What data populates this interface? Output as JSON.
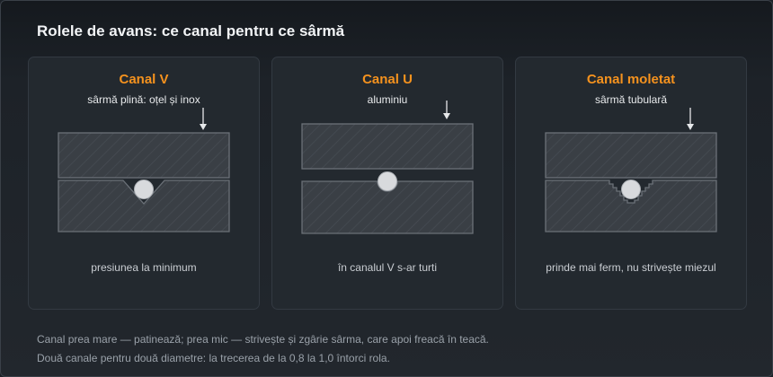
{
  "title": "Rolele de avans: ce canal pentru ce sârmă",
  "colors": {
    "accent": "#f5921e",
    "roll_fill": "#3a3f45",
    "roll_stroke": "#6b7178",
    "wire": "#d8dadd"
  },
  "cards": [
    {
      "heading": "Canal V",
      "subtitle": "sârmă plină: oțel și inox",
      "caption": "presiunea la minimum",
      "groove": "v",
      "arrow_icon": "arrow-down-icon"
    },
    {
      "heading": "Canal U",
      "subtitle": "aluminiu",
      "caption": "în canalul V s-ar turti",
      "groove": "u",
      "arrow_icon": "arrow-down-icon"
    },
    {
      "heading": "Canal moletat",
      "subtitle": "sârmă tubulară",
      "caption": "prinde mai ferm, nu strivește miezul",
      "groove": "knurled",
      "arrow_icon": "arrow-down-icon"
    }
  ],
  "footer": {
    "line1": "Canal prea mare — patinează; prea mic — strivește și zgârie sârma, care apoi freacă în teacă.",
    "line2": "Două canale pentru două diametre: la trecerea de la 0,8 la 1,0 întorci rola."
  }
}
